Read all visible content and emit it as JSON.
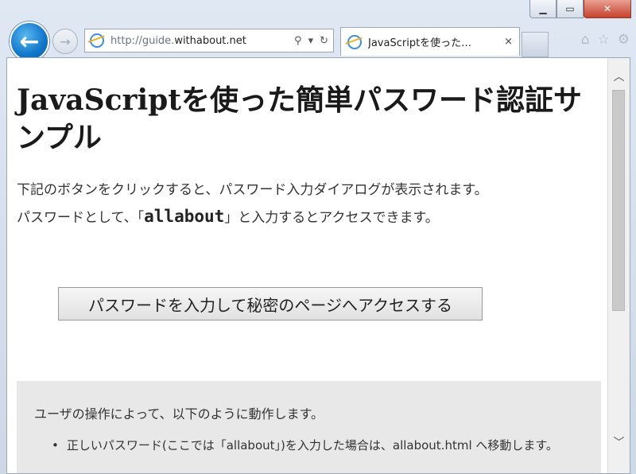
{
  "browser": {
    "address_url_prefix": "http://guide.",
    "address_url_domain": "withabout.net",
    "tab_title": "JavaScriptを使った…",
    "tab_close": "×"
  },
  "page": {
    "title": "JavaScriptを使った簡単パスワード認証サンプル",
    "desc_line1": "下記のボタンをクリックすると、パスワード入力ダイアログが表示されます。",
    "desc_line2_before": "パスワードとして、「",
    "desc_password": "allabout",
    "desc_line2_after": "」と入力するとアクセスできます。",
    "access_button": "パスワードを入力して秘密のページへアクセスする",
    "note_text": "ユーザの操作によって、以下のように動作します。",
    "note_items": [
      "正しいパスワード(ここでは「allabout」)を入力した場合は、allabout.html へ移動します。"
    ]
  },
  "icons": {
    "back": "back-arrow-icon",
    "forward": "forward-arrow-icon",
    "search": "search-icon",
    "refresh": "refresh-icon",
    "home": "home-icon",
    "favorites": "star-icon",
    "tools": "gear-icon"
  }
}
